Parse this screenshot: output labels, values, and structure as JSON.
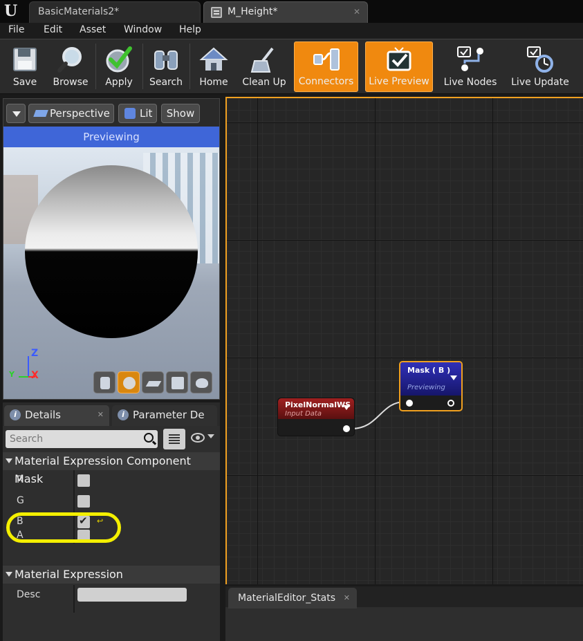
{
  "tabs": [
    {
      "label": "BasicMaterials2*"
    },
    {
      "label": "M_Height*"
    }
  ],
  "menu": [
    "File",
    "Edit",
    "Asset",
    "Window",
    "Help"
  ],
  "toolbar": {
    "buttons": [
      {
        "label": "Save",
        "icon": "floppy-disk-icon",
        "active": false
      },
      {
        "label": "Browse",
        "icon": "magnifier-icon",
        "active": false
      },
      {
        "label": "Apply",
        "icon": "checkmark-icon",
        "active": false
      },
      {
        "label": "Search",
        "icon": "binoculars-icon",
        "active": false
      },
      {
        "label": "Home",
        "icon": "house-icon",
        "active": false
      },
      {
        "label": "Clean Up",
        "icon": "broom-icon",
        "active": false
      },
      {
        "label": "Connectors",
        "icon": "connector-icon",
        "active": true
      },
      {
        "label": "Live Preview",
        "icon": "tv-check-icon",
        "active": true
      },
      {
        "label": "Live Nodes",
        "icon": "live-nodes-icon",
        "active": false
      },
      {
        "label": "Live Update",
        "icon": "live-update-icon",
        "active": false
      }
    ],
    "active_color": "#f0890f"
  },
  "viewport": {
    "perspective_label": "Perspective",
    "lit_label": "Lit",
    "show_label": "Show",
    "banner": "Previewing",
    "axis_z": "Z",
    "axis_x": "X",
    "axis_y": "Y"
  },
  "details": {
    "tab_details": "Details",
    "tab_params": "Parameter De",
    "search_placeholder": "Search",
    "section1": "Material Expression Component Mask",
    "props": [
      {
        "label": "R",
        "checked": false
      },
      {
        "label": "G",
        "checked": false
      },
      {
        "label": "B",
        "checked": true
      },
      {
        "label": "A",
        "checked": false
      }
    ],
    "section2": "Material Expression",
    "desc_label": "Desc",
    "desc_value": ""
  },
  "graph": {
    "node1": {
      "title": "PixelNormalWS",
      "subtitle": "Input Data"
    },
    "node2": {
      "title": "Mask ( B )",
      "subtitle": "Previewing"
    }
  },
  "stats": {
    "tab": "MaterialEditor_Stats"
  },
  "colors": {
    "highlight": "#f4ef00",
    "previewing_bar": "#3f66d8",
    "node1_header": "#8c1d1d",
    "node2_header": "#1a1a9a",
    "node2_border": "#f0a020"
  }
}
